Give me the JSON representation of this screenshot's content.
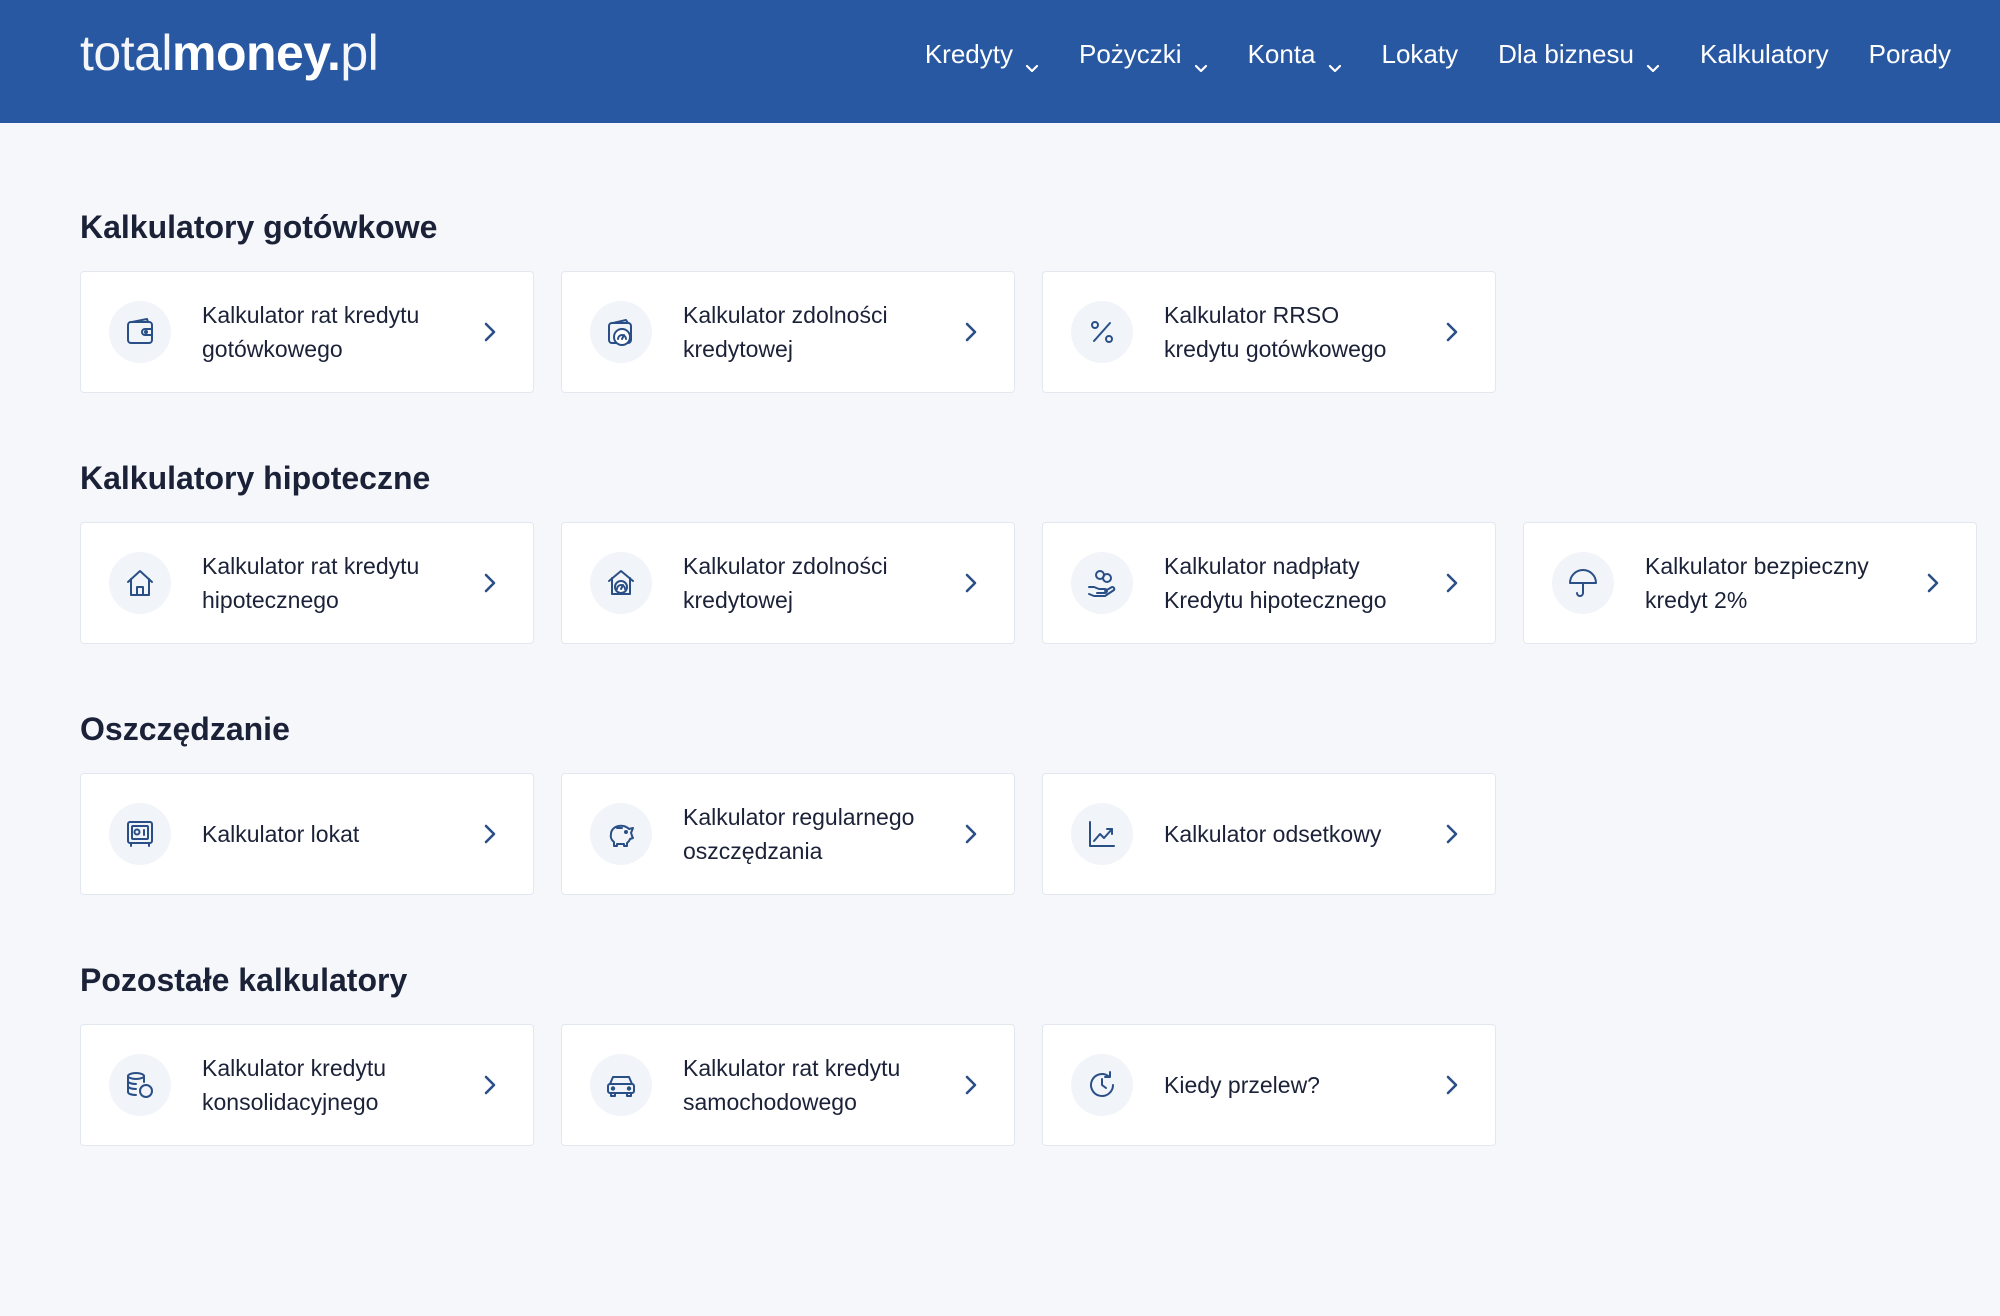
{
  "header": {
    "logo_thin": "total",
    "logo_bold": "money",
    "logo_dot": ".",
    "logo_tld": "pl",
    "nav": [
      {
        "label": "Kredyty",
        "dropdown": true
      },
      {
        "label": "Pożyczki",
        "dropdown": true
      },
      {
        "label": "Konta",
        "dropdown": true
      },
      {
        "label": "Lokaty",
        "dropdown": false
      },
      {
        "label": "Dla biznesu",
        "dropdown": true
      },
      {
        "label": "Kalkulatory",
        "dropdown": false
      },
      {
        "label": "Porady",
        "dropdown": false
      }
    ]
  },
  "colors": {
    "header_bg": "#2958a2",
    "page_bg": "#f5f7fb",
    "icon_stroke": "#2a4f87"
  },
  "sections": [
    {
      "title": "Kalkulatory gotówkowe",
      "cards": [
        {
          "label": "Kalkulator rat kredytu\ngotówkowego",
          "icon": "wallet-icon"
        },
        {
          "label": "Kalkulator zdolności\nkredytowej",
          "icon": "wallet-gauge-icon"
        },
        {
          "label": "Kalkulator RRSO\nkredytu gotówkowego",
          "icon": "percent-icon"
        }
      ]
    },
    {
      "title": "Kalkulatory hipoteczne",
      "cards": [
        {
          "label": "Kalkulator rat kredytu\nhipotecznego",
          "icon": "house-icon"
        },
        {
          "label": "Kalkulator zdolności\nkredytowej",
          "icon": "house-gauge-icon"
        },
        {
          "label": "Kalkulator nadpłaty\nKredytu hipotecznego",
          "icon": "hand-coins-icon"
        },
        {
          "label": "Kalkulator bezpieczny\nkredyt 2%",
          "icon": "umbrella-icon"
        }
      ]
    },
    {
      "title": "Oszczędzanie",
      "cards": [
        {
          "label": "Kalkulator lokat",
          "icon": "safe-icon"
        },
        {
          "label": "Kalkulator regularnego\noszczędzania",
          "icon": "piggy-bank-icon"
        },
        {
          "label": "Kalkulator odsetkowy",
          "icon": "trend-chart-icon"
        }
      ]
    },
    {
      "title": "Pozostałe kalkulatory",
      "cards": [
        {
          "label": "Kalkulator kredytu\nkonsolidacyjnego",
          "icon": "coins-stack-icon"
        },
        {
          "label": "Kalkulator rat kredytu\nsamochodowego",
          "icon": "car-icon"
        },
        {
          "label": "Kiedy przelew?",
          "icon": "clock-icon"
        }
      ]
    }
  ]
}
